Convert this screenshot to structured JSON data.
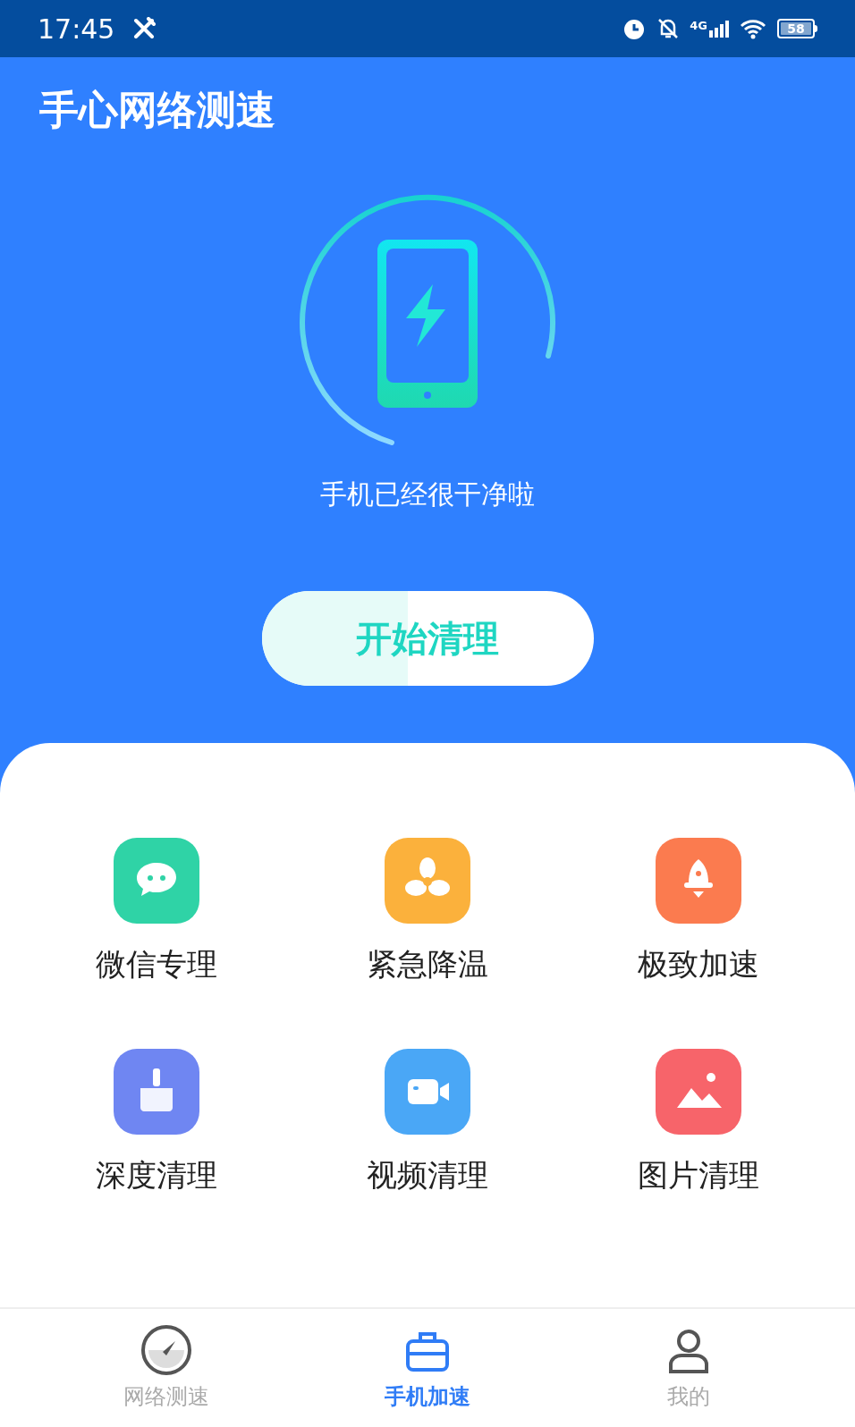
{
  "status_bar": {
    "time": "17:45",
    "network": "4G",
    "battery": "58"
  },
  "app_title": "手心网络测速",
  "status_text": "手机已经很干净啦",
  "clean_button": {
    "label": "开始清理",
    "level": 0.44
  },
  "tools": [
    {
      "label": "微信专理",
      "kind": "chat",
      "color": "#2fd3a6"
    },
    {
      "label": "紧急降温",
      "kind": "fan",
      "color": "#fbb13c"
    },
    {
      "label": "极致加速",
      "kind": "rocket",
      "color": "#fb7b4f"
    },
    {
      "label": "深度清理",
      "kind": "broom",
      "color": "#6f86f2"
    },
    {
      "label": "视频清理",
      "kind": "video",
      "color": "#4aa7f6"
    },
    {
      "label": "图片清理",
      "kind": "image",
      "color": "#f7646a"
    }
  ],
  "tabs": [
    {
      "label": "网络测速",
      "kind": "gauge",
      "selected": false
    },
    {
      "label": "手机加速",
      "kind": "bag",
      "selected": true
    },
    {
      "label": "我的",
      "kind": "person",
      "selected": false
    }
  ]
}
